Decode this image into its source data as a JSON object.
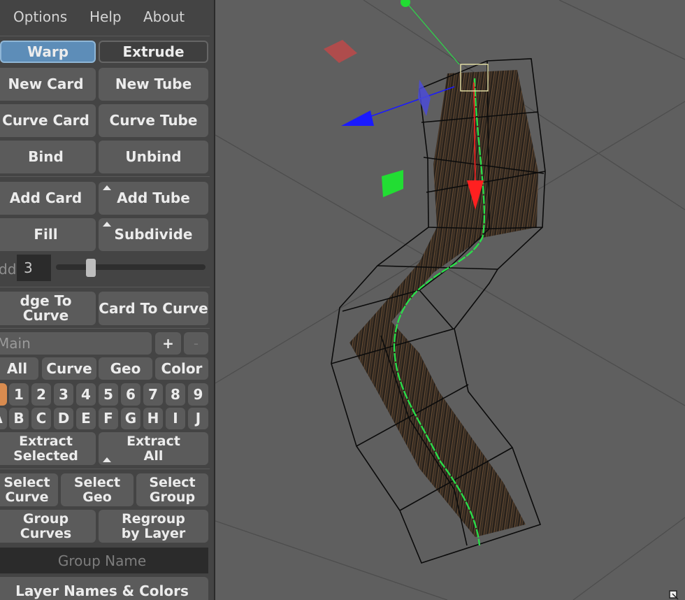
{
  "menu": [
    "Options",
    "Help",
    "About"
  ],
  "mode_tabs": {
    "warp": "Warp",
    "extrude": "Extrude"
  },
  "buttons": {
    "new_card": "New Card",
    "new_tube": "New Tube",
    "curve_card": "Curve Card",
    "curve_tube": "Curve Tube",
    "bind": "Bind",
    "unbind": "Unbind",
    "add_card": "Add Card",
    "add_tube": "Add Tube",
    "fill": "Fill",
    "subdivide": "Subdivide",
    "edge_to_curve": "dge To Curve",
    "card_to_curve": "Card To Curve",
    "extract_selected": "Extract\nSelected",
    "extract_all": "Extract\nAll",
    "select_curve": "Select\nCurve",
    "select_geo": "Select\nGeo",
    "select_group": "Select\nGroup",
    "group_curves": "Group\nCurves",
    "regroup_by_layer": "Regroup\nby Layer",
    "layer_names_colors": "Layer Names & Colors"
  },
  "add_row": {
    "label": "dd",
    "value": "3",
    "slider_value": 0.22
  },
  "layer_collection": {
    "name": "Main",
    "add": "+",
    "remove": "-"
  },
  "filters": [
    "All",
    "Curve",
    "Geo",
    "Color"
  ],
  "number_layers": [
    "1",
    "2",
    "3",
    "4",
    "5",
    "6",
    "7",
    "8",
    "9"
  ],
  "letter_layers": [
    "A",
    "B",
    "C",
    "D",
    "E",
    "F",
    "G",
    "H",
    "I",
    "J"
  ],
  "group_name_placeholder": "Group Name",
  "colors": {
    "panel_bg": "#444444",
    "button_bg": "#5b5b5b",
    "active_tab": "#5d8db8",
    "selected_layer": "#d88b4f",
    "viewport_bg": "#5f5f5f",
    "curve_green": "#29e04a",
    "gizmo_red": "#ff2020",
    "gizmo_blue": "#1a1aff",
    "gizmo_green": "#22dd33"
  }
}
